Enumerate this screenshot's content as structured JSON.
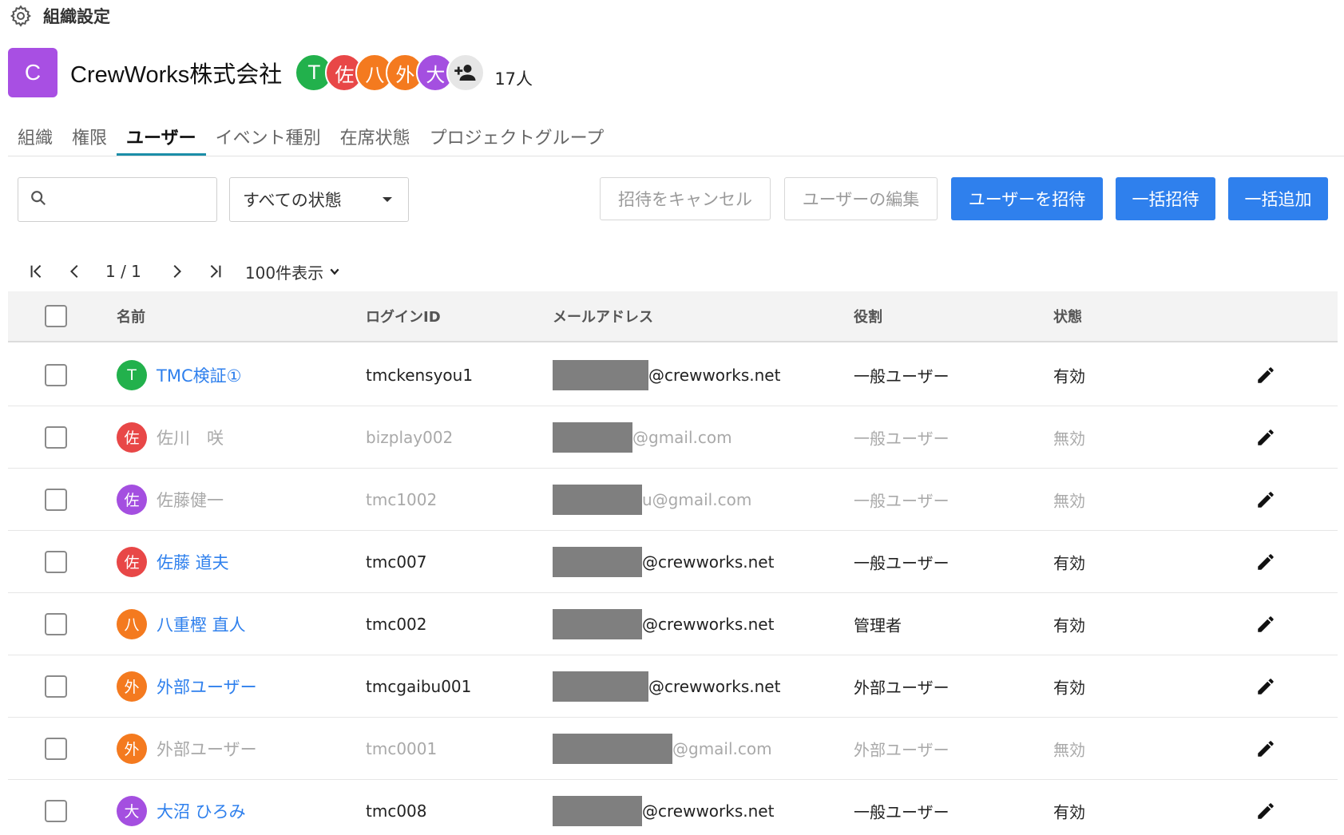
{
  "header": {
    "title": "組織設定",
    "icon": "gear-icon"
  },
  "org": {
    "logo_letter": "C",
    "logo_color": "#a84fe3",
    "name": "CrewWorks株式会社",
    "member_count": "17人",
    "avatars": [
      {
        "letter": "T",
        "color": "#22b14c"
      },
      {
        "letter": "佐",
        "color": "#e84747"
      },
      {
        "letter": "八",
        "color": "#f47a1f"
      },
      {
        "letter": "外",
        "color": "#f47a1f"
      },
      {
        "letter": "大",
        "color": "#a44fe0"
      }
    ]
  },
  "tabs": [
    "組織",
    "権限",
    "ユーザー",
    "イベント種別",
    "在席状態",
    "プロジェクトグループ"
  ],
  "active_tab": "ユーザー",
  "search": {
    "placeholder": "",
    "value": ""
  },
  "status_filter": {
    "selected": "すべての状態"
  },
  "actions": {
    "cancel_invite": "招待をキャンセル",
    "edit_users": "ユーザーの編集",
    "invite_user": "ユーザーを招待",
    "bulk_invite": "一括招待",
    "bulk_add": "一括追加"
  },
  "pagination": {
    "page": "1 / 1",
    "page_size": "100件表示"
  },
  "table": {
    "columns": {
      "name": "名前",
      "login": "ログインID",
      "email": "メールアドレス",
      "role": "役割",
      "status": "状態"
    },
    "rows": [
      {
        "avatar": "T",
        "avatar_color": "#22b14c",
        "name": "TMC検証①",
        "login": "tmckensyou1",
        "email_domain": "@crewworks.net",
        "role": "一般ユーザー",
        "status": "有効",
        "active": true
      },
      {
        "avatar": "佐",
        "avatar_color": "#e84747",
        "name": "佐川　咲",
        "login": "bizplay002",
        "email_domain": "@gmail.com",
        "role": "一般ユーザー",
        "status": "無効",
        "active": false
      },
      {
        "avatar": "佐",
        "avatar_color": "#a44fe0",
        "name": "佐藤健一",
        "login": "tmc1002",
        "email_domain": "u@gmail.com",
        "role": "一般ユーザー",
        "status": "無効",
        "active": false
      },
      {
        "avatar": "佐",
        "avatar_color": "#e84747",
        "name": "佐藤 道夫",
        "login": "tmc007",
        "email_domain": "@crewworks.net",
        "role": "一般ユーザー",
        "status": "有効",
        "active": true
      },
      {
        "avatar": "八",
        "avatar_color": "#f47a1f",
        "name": "八重樫 直人",
        "login": "tmc002",
        "email_domain": "@crewworks.net",
        "role": "管理者",
        "status": "有効",
        "active": true
      },
      {
        "avatar": "外",
        "avatar_color": "#f47a1f",
        "name": "外部ユーザー",
        "login": "tmcgaibu001",
        "email_domain": "@crewworks.net",
        "role": "外部ユーザー",
        "status": "有効",
        "active": true
      },
      {
        "avatar": "外",
        "avatar_color": "#f47a1f",
        "name": "外部ユーザー",
        "login": "tmc0001",
        "email_domain": "@gmail.com",
        "role": "外部ユーザー",
        "status": "無効",
        "active": false
      },
      {
        "avatar": "大",
        "avatar_color": "#a44fe0",
        "name": "大沼 ひろみ",
        "login": "tmc008",
        "email_domain": "@crewworks.net",
        "role": "一般ユーザー",
        "status": "有効",
        "active": true
      }
    ]
  }
}
